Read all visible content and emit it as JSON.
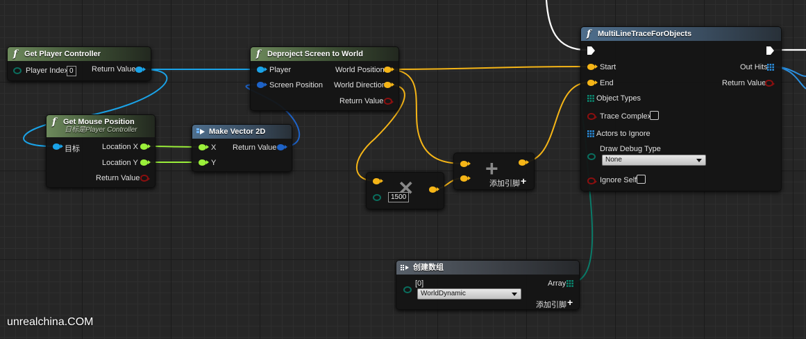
{
  "nodes": {
    "get_player_controller": {
      "title": "Get Player Controller",
      "player_index_label": "Player Index",
      "player_index_value": "0",
      "return_value": "Return Value"
    },
    "get_mouse_position": {
      "title": "Get Mouse Position",
      "subtitle": "目标是Player Controller",
      "target": "目标",
      "location_x": "Location X",
      "location_y": "Location Y",
      "return_value": "Return Value"
    },
    "make_vector_2d": {
      "title": "Make Vector 2D",
      "x": "X",
      "y": "Y",
      "return_value": "Return Value"
    },
    "deproject": {
      "title": "Deproject Screen to World",
      "player": "Player",
      "screen_position": "Screen Position",
      "world_position": "World Position",
      "world_direction": "World Direction",
      "return_value": "Return Value"
    },
    "multiply": {
      "value": "1500"
    },
    "add": {
      "add_pin": "添加引脚"
    },
    "make_array": {
      "title": "创建数组",
      "index0": "[0]",
      "dropdown_value": "WorldDynamic",
      "array": "Array",
      "add_pin": "添加引脚"
    },
    "multi_line_trace": {
      "title": "MultiLineTraceForObjects",
      "start": "Start",
      "end": "End",
      "out_hits": "Out Hits",
      "return_value": "Return Value",
      "object_types": "Object Types",
      "trace_complex": "Trace Complex",
      "actors_to_ignore": "Actors to Ignore",
      "draw_debug_type": "Draw Debug Type",
      "draw_debug_value": "None",
      "ignore_self": "Ignore Self"
    }
  },
  "watermark": "unrealchina.COM",
  "colors": {
    "object_pin": "#1aa3e8",
    "vector_pin": "#f5b517",
    "float_pin": "#9bf03a",
    "vector2d_pin": "#1e63c8",
    "bool_pin": "#8a0f0f",
    "enum_pin": "#0a6e5e",
    "byte_pin": "#0a6e5e",
    "exec_pin": "#ffffff",
    "array_pin": "#2a8fe0"
  }
}
